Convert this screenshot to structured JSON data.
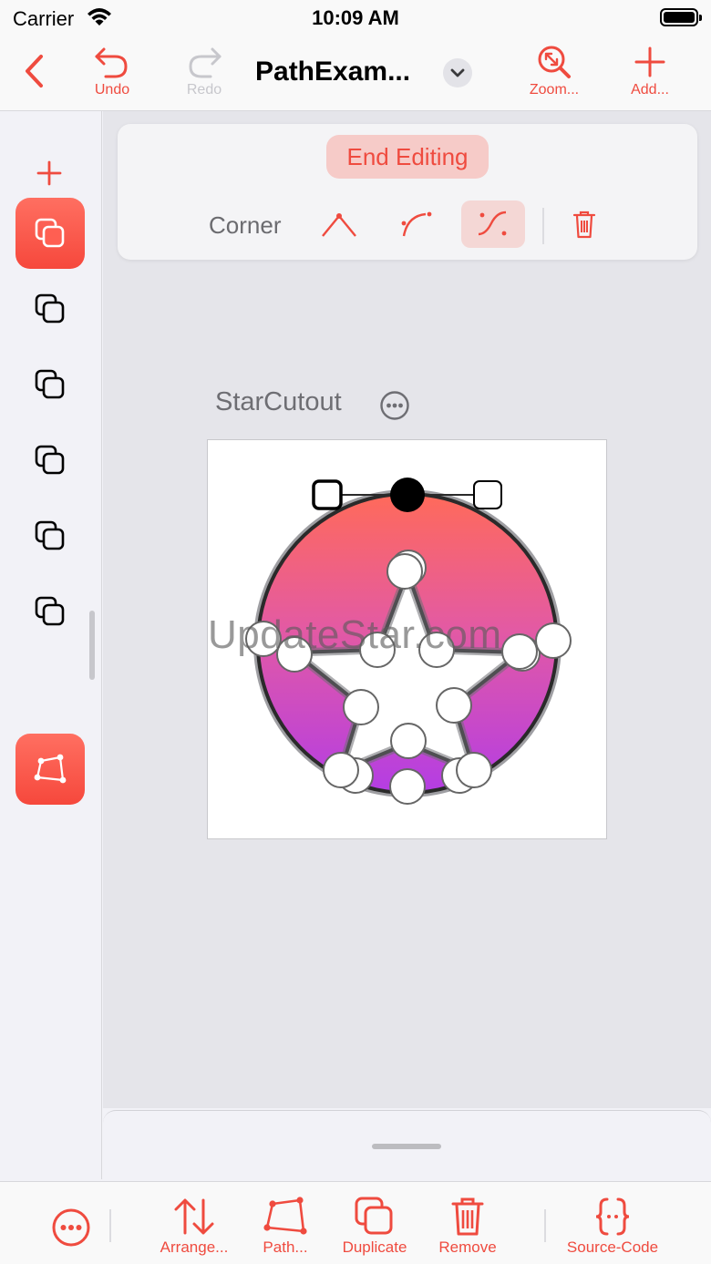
{
  "status_bar": {
    "carrier": "Carrier",
    "time": "10:09 AM"
  },
  "nav": {
    "title": "PathExam...",
    "undo_label": "Undo",
    "redo_label": "Redo",
    "zoom_label": "Zoom...",
    "add_label": "Add..."
  },
  "edit_toolbar": {
    "end_editing_label": "End Editing",
    "corner_label": "Corner"
  },
  "shape": {
    "name": "StarCutout"
  },
  "watermark": "UpdateStar.com",
  "bottom_toolbar": {
    "arrange_label": "Arrange...",
    "path_label": "Path...",
    "duplicate_label": "Duplicate",
    "remove_label": "Remove",
    "source_code_label": "Source-Code"
  },
  "colors": {
    "accent": "#ef4b3f",
    "gradient_top": "#ff6a5a",
    "gradient_mid": "#e35aa3",
    "gradient_bottom": "#b43de4"
  }
}
